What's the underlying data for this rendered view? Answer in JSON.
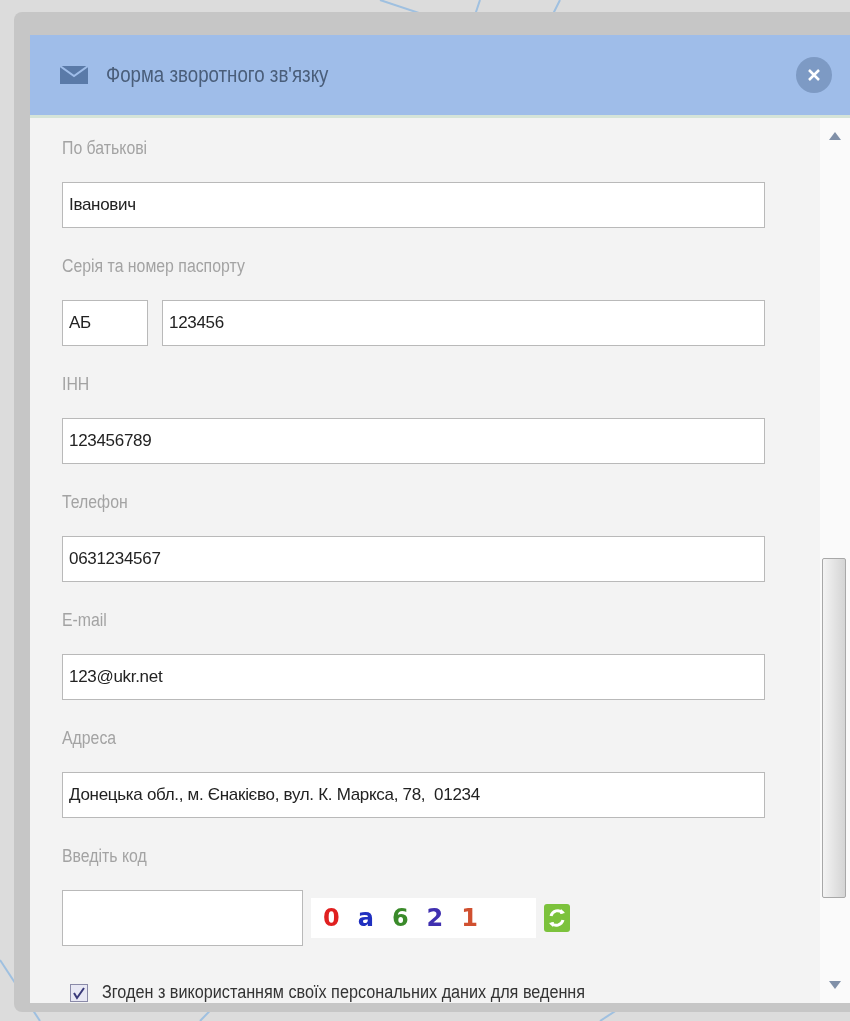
{
  "window": {
    "title": "Форма зворотного зв'язку"
  },
  "fields": [
    {
      "kind": "text",
      "label": "По батькові",
      "values": [
        "Іванович"
      ]
    },
    {
      "kind": "split",
      "label": "Серія та номер паспорту",
      "values": [
        "АБ",
        "123456"
      ]
    },
    {
      "kind": "text",
      "label": "ІНН",
      "values": [
        "123456789"
      ]
    },
    {
      "kind": "text",
      "label": "Телефон",
      "values": [
        "0631234567"
      ]
    },
    {
      "kind": "text",
      "label": "E-mail",
      "values": [
        "123@ukr.net"
      ]
    },
    {
      "kind": "text",
      "label": "Адреса",
      "values": [
        "Донецька обл., м. Єнакієво, вул. К. Маркса, 78,  01234"
      ]
    },
    {
      "kind": "captcha",
      "label": "Введіть код"
    }
  ],
  "captcha": [
    {
      "char": "0",
      "color": "#e02020"
    },
    {
      "char": "a",
      "color": "#2030c0"
    },
    {
      "char": "6",
      "color": "#3a8a2a"
    },
    {
      "char": "2",
      "color": "#4030b0"
    },
    {
      "char": "1",
      "color": "#d05030"
    }
  ],
  "consent": {
    "checked": true,
    "text": "Згоден з використанням своїх персональних даних для ведення"
  }
}
